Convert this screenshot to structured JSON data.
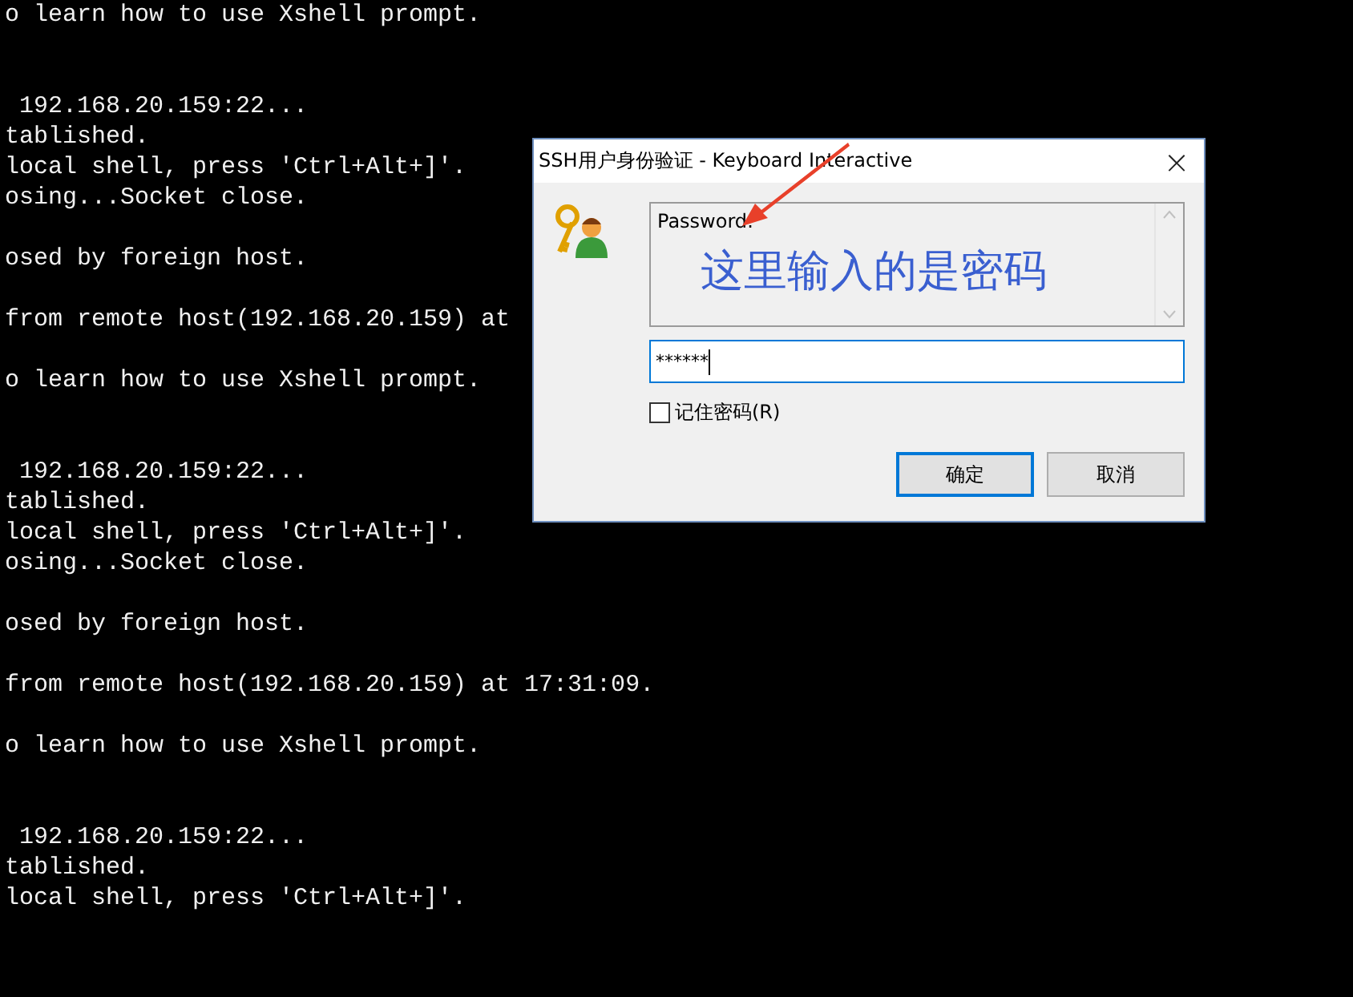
{
  "terminal": {
    "lines": [
      {
        "kind": "text",
        "text": "o learn how to use Xshell prompt."
      },
      {
        "kind": "blank"
      },
      {
        "kind": "blank"
      },
      {
        "kind": "text",
        "text": " 192.168.20.159:22..."
      },
      {
        "kind": "text",
        "text": "tablished."
      },
      {
        "kind": "text",
        "text": "local shell, press 'Ctrl+Alt+]'."
      },
      {
        "kind": "text",
        "text": "osing...Socket close."
      },
      {
        "kind": "blank"
      },
      {
        "kind": "text",
        "text": "osed by foreign host."
      },
      {
        "kind": "blank"
      },
      {
        "kind": "text",
        "text": "from remote host(192.168.20.159) at"
      },
      {
        "kind": "blank"
      },
      {
        "kind": "text",
        "text": "o learn how to use Xshell prompt."
      },
      {
        "kind": "blank"
      },
      {
        "kind": "blank"
      },
      {
        "kind": "text",
        "text": " 192.168.20.159:22..."
      },
      {
        "kind": "text",
        "text": "tablished."
      },
      {
        "kind": "text",
        "text": "local shell, press 'Ctrl+Alt+]'."
      },
      {
        "kind": "text",
        "text": "osing...Socket close."
      },
      {
        "kind": "blank"
      },
      {
        "kind": "text",
        "text": "osed by foreign host."
      },
      {
        "kind": "blank"
      },
      {
        "kind": "text",
        "text": "from remote host(192.168.20.159) at 17:31:09."
      },
      {
        "kind": "blank"
      },
      {
        "kind": "text",
        "text": "o learn how to use Xshell prompt."
      },
      {
        "kind": "blank"
      },
      {
        "kind": "blank"
      },
      {
        "kind": "text",
        "text": " 192.168.20.159:22..."
      },
      {
        "kind": "text",
        "text": "tablished."
      },
      {
        "kind": "text",
        "text": "local shell, press 'Ctrl+Alt+]'."
      }
    ]
  },
  "dialog": {
    "title": "SSH用户身份验证 - Keyboard Interactive",
    "close": "×",
    "prompt": "Password:",
    "annotation": "这里输入的是密码",
    "password": "******",
    "remember": {
      "label": "记住密码(R)",
      "checked": false
    },
    "buttons": [
      {
        "label": "确定",
        "default": true
      },
      {
        "label": "取消",
        "default": false
      }
    ]
  }
}
